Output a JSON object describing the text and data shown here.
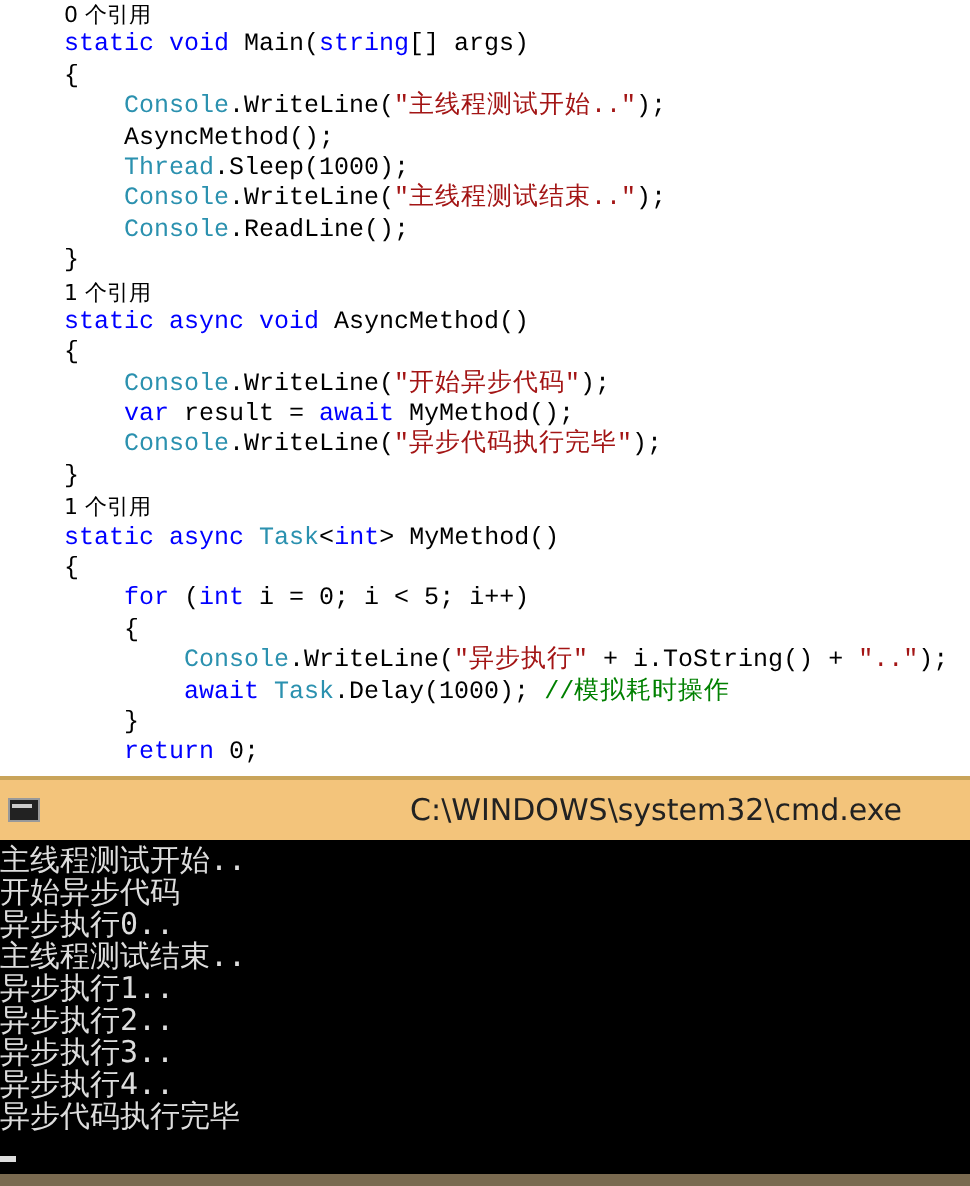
{
  "editor": {
    "lines": [
      {
        "kind": "codelens",
        "tokens": [
          {
            "kind": "plain",
            "text": "0 个引用"
          }
        ]
      },
      {
        "kind": "top",
        "tokens": [
          {
            "kind": "keyword",
            "text": "static void "
          },
          {
            "kind": "plain",
            "text": "Main("
          },
          {
            "kind": "keyword",
            "text": "string"
          },
          {
            "kind": "plain",
            "text": "[] args)"
          }
        ]
      },
      {
        "kind": "top",
        "tokens": [
          {
            "kind": "plain",
            "text": "{"
          }
        ]
      },
      {
        "kind": "inner",
        "tokens": [
          {
            "kind": "type",
            "text": "Console"
          },
          {
            "kind": "plain",
            "text": ".WriteLine("
          },
          {
            "kind": "string",
            "text": "\"主线程测试开始..\""
          },
          {
            "kind": "plain",
            "text": ");"
          }
        ]
      },
      {
        "kind": "inner",
        "tokens": [
          {
            "kind": "plain",
            "text": "AsyncMethod();"
          }
        ]
      },
      {
        "kind": "inner",
        "tokens": [
          {
            "kind": "type",
            "text": "Thread"
          },
          {
            "kind": "plain",
            "text": ".Sleep(1000);"
          }
        ]
      },
      {
        "kind": "inner",
        "tokens": [
          {
            "kind": "type",
            "text": "Console"
          },
          {
            "kind": "plain",
            "text": ".WriteLine("
          },
          {
            "kind": "string",
            "text": "\"主线程测试结束..\""
          },
          {
            "kind": "plain",
            "text": ");"
          }
        ]
      },
      {
        "kind": "inner",
        "tokens": [
          {
            "kind": "type",
            "text": "Console"
          },
          {
            "kind": "plain",
            "text": ".ReadLine();"
          }
        ]
      },
      {
        "kind": "top",
        "tokens": [
          {
            "kind": "plain",
            "text": "}"
          }
        ]
      },
      {
        "kind": "codelens",
        "tokens": [
          {
            "kind": "plain",
            "text": "1 个引用"
          }
        ]
      },
      {
        "kind": "top",
        "tokens": [
          {
            "kind": "keyword",
            "text": "static async void "
          },
          {
            "kind": "plain",
            "text": "AsyncMethod()"
          }
        ]
      },
      {
        "kind": "top",
        "tokens": [
          {
            "kind": "plain",
            "text": "{"
          }
        ]
      },
      {
        "kind": "inner",
        "tokens": [
          {
            "kind": "type",
            "text": "Console"
          },
          {
            "kind": "plain",
            "text": ".WriteLine("
          },
          {
            "kind": "string",
            "text": "\"开始异步代码\""
          },
          {
            "kind": "plain",
            "text": ");"
          }
        ]
      },
      {
        "kind": "inner",
        "tokens": [
          {
            "kind": "keyword",
            "text": "var"
          },
          {
            "kind": "plain",
            "text": " result = "
          },
          {
            "kind": "keyword",
            "text": "await"
          },
          {
            "kind": "plain",
            "text": " MyMethod();"
          }
        ]
      },
      {
        "kind": "inner",
        "tokens": [
          {
            "kind": "type",
            "text": "Console"
          },
          {
            "kind": "plain",
            "text": ".WriteLine("
          },
          {
            "kind": "string",
            "text": "\"异步代码执行完毕\""
          },
          {
            "kind": "plain",
            "text": ");"
          }
        ]
      },
      {
        "kind": "top",
        "tokens": [
          {
            "kind": "plain",
            "text": "}"
          }
        ]
      },
      {
        "kind": "codelens",
        "tokens": [
          {
            "kind": "plain",
            "text": "1 个引用"
          }
        ]
      },
      {
        "kind": "top",
        "tokens": [
          {
            "kind": "keyword",
            "text": "static async "
          },
          {
            "kind": "type",
            "text": "Task"
          },
          {
            "kind": "plain",
            "text": "<"
          },
          {
            "kind": "keyword",
            "text": "int"
          },
          {
            "kind": "plain",
            "text": "> MyMethod()"
          }
        ]
      },
      {
        "kind": "top",
        "tokens": [
          {
            "kind": "plain",
            "text": "{"
          }
        ]
      },
      {
        "kind": "inner",
        "tokens": [
          {
            "kind": "keyword",
            "text": "for"
          },
          {
            "kind": "plain",
            "text": " ("
          },
          {
            "kind": "keyword",
            "text": "int"
          },
          {
            "kind": "plain",
            "text": " i = 0; i < 5; i++)"
          }
        ]
      },
      {
        "kind": "inner",
        "tokens": [
          {
            "kind": "plain",
            "text": "{"
          }
        ]
      },
      {
        "kind": "deep",
        "tokens": [
          {
            "kind": "type",
            "text": "Console"
          },
          {
            "kind": "plain",
            "text": ".WriteLine("
          },
          {
            "kind": "string",
            "text": "\"异步执行\""
          },
          {
            "kind": "plain",
            "text": " + i.ToString() + "
          },
          {
            "kind": "string",
            "text": "\"..\""
          },
          {
            "kind": "plain",
            "text": ");"
          }
        ]
      },
      {
        "kind": "deep",
        "tokens": [
          {
            "kind": "keyword",
            "text": "await "
          },
          {
            "kind": "type",
            "text": "Task"
          },
          {
            "kind": "plain",
            "text": ".Delay(1000); "
          },
          {
            "kind": "comment",
            "text": "//模拟耗时操作"
          }
        ]
      },
      {
        "kind": "inner",
        "tokens": [
          {
            "kind": "plain",
            "text": "}"
          }
        ]
      },
      {
        "kind": "inner",
        "tokens": [
          {
            "kind": "keyword",
            "text": "return"
          },
          {
            "kind": "plain",
            "text": " 0;"
          }
        ]
      }
    ]
  },
  "console": {
    "title": "C:\\WINDOWS\\system32\\cmd.exe",
    "lines": [
      "主线程测试开始..",
      "开始异步代码",
      "异步执行0..",
      "主线程测试结束..",
      "异步执行1..",
      "异步执行2..",
      "异步执行3..",
      "异步执行4..",
      "异步代码执行完毕"
    ]
  }
}
